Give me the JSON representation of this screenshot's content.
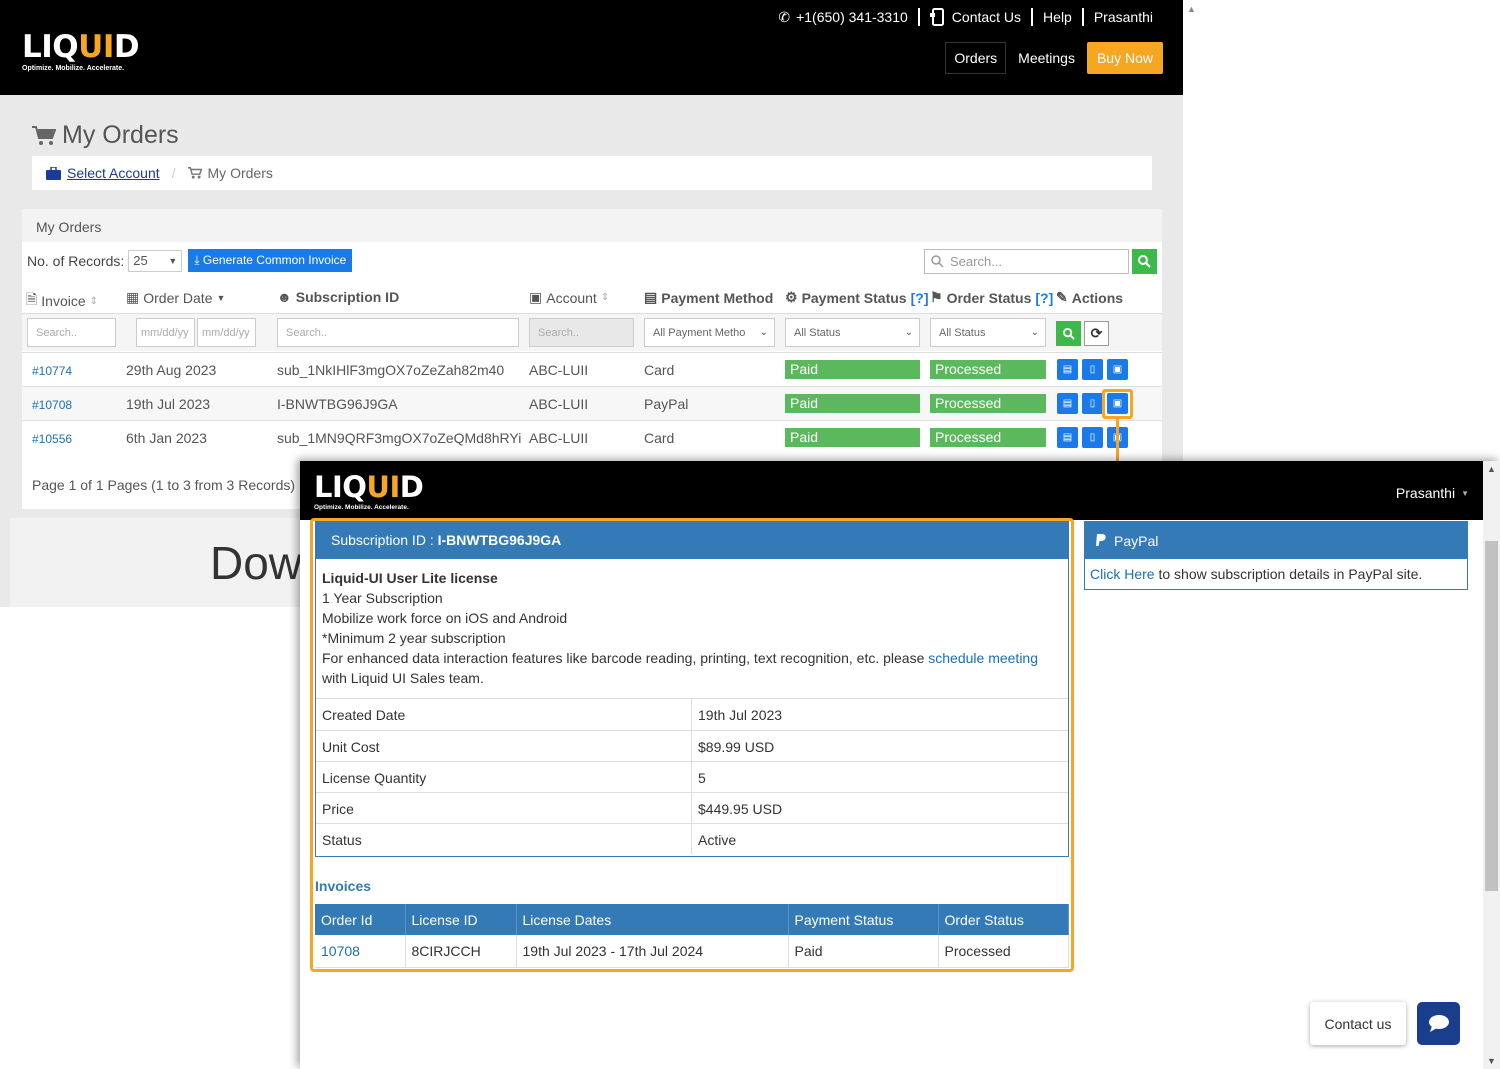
{
  "brand": {
    "wordmark_main": "LIQ",
    "wordmark_accent": "UI",
    "wordmark_end": "D",
    "tagline": "Optimize. Mobilize. Accelerate."
  },
  "colors": {
    "accent": "#f5a623",
    "primary": "#337ab7",
    "success": "#5cb85c",
    "button_blue": "#1a7be8"
  },
  "top_links": {
    "phone": "+1(650) 341-3310",
    "contact": "Contact Us",
    "help": "Help",
    "user": "Prasanthi"
  },
  "main_nav": {
    "orders": "Orders",
    "meetings": "Meetings",
    "buy_now": "Buy Now"
  },
  "page": {
    "title": "My Orders",
    "breadcrumb": {
      "root": "Select Account",
      "current": "My Orders"
    }
  },
  "orders_panel": {
    "heading": "My Orders",
    "records_label": "No. of Records:",
    "records_value": "25",
    "generate_label": "Generate Common Invoice",
    "search_placeholder": "Search...",
    "columns": {
      "invoice": "Invoice",
      "order_date": "Order Date",
      "subscription_id": "Subscription ID",
      "account": "Account",
      "payment_method": "Payment Method",
      "payment_status": "Payment Status",
      "order_status": "Order Status",
      "help_mark": "[?]",
      "actions": "Actions"
    },
    "filters": {
      "invoice": "Search..",
      "date_from": "mm/dd/yy",
      "date_to": "mm/dd/yy",
      "subscription": "Search..",
      "account": "Search..",
      "payment_method": "All Payment Metho",
      "payment_status": "All Status",
      "order_status": "All Status"
    },
    "rows": [
      {
        "invoice": "#10774",
        "date": "29th Aug 2023",
        "sub_id": "sub_1NkIHlF3mgOX7oZeZah82m40",
        "account": "ABC-LUII",
        "method": "Card",
        "pay_status": "Paid",
        "order_status": "Processed"
      },
      {
        "invoice": "#10708",
        "date": "19th Jul 2023",
        "sub_id": "I-BNWTBG96J9GA",
        "account": "ABC-LUII",
        "method": "PayPal",
        "pay_status": "Paid",
        "order_status": "Processed"
      },
      {
        "invoice": "#10556",
        "date": "6th Jan 2023",
        "sub_id": "sub_1MN9QRF3mgOX7oZeQMd8hRYi",
        "account": "ABC-LUII",
        "method": "Card",
        "pay_status": "Paid",
        "order_status": "Processed"
      }
    ],
    "pager": "Page 1 of 1 Pages (1 to 3 from 3 Records)"
  },
  "background_banner": "Dow",
  "popup": {
    "user": "Prasanthi",
    "subscription": {
      "label": "Subscription ID :",
      "id": "I-BNWTBG96J9GA",
      "product": "Liquid-UI User Lite license",
      "line1": "1 Year Subscription",
      "line2": "Mobilize work force on iOS and Android",
      "line3": "*Minimum 2 year subscription",
      "line4_pre": "For enhanced data interaction features like barcode reading, printing, text recognition, etc. please ",
      "line4_link": "schedule meeting",
      "line4_post": " with Liquid UI Sales team.",
      "details": [
        {
          "label": "Created Date",
          "value": "19th Jul 2023"
        },
        {
          "label": "Unit Cost",
          "value": "$89.99 USD"
        },
        {
          "label": "License Quantity",
          "value": "5"
        },
        {
          "label": "Price",
          "value": "$449.95 USD"
        },
        {
          "label": "Status",
          "value": "Active"
        }
      ]
    },
    "invoices": {
      "title": "Invoices",
      "headers": [
        "Order Id",
        "License ID",
        "License Dates",
        "Payment Status",
        "Order Status"
      ],
      "rows": [
        {
          "order_id": "10708",
          "license_id": "8CIRJCCH",
          "dates": "19th Jul 2023 - 17th Jul 2024",
          "payment": "Paid",
          "status": "Processed"
        }
      ]
    },
    "paypal": {
      "title": "PayPal",
      "link": "Click Here",
      "text": " to show subscription details in PayPal site."
    },
    "contact_label": "Contact us"
  }
}
